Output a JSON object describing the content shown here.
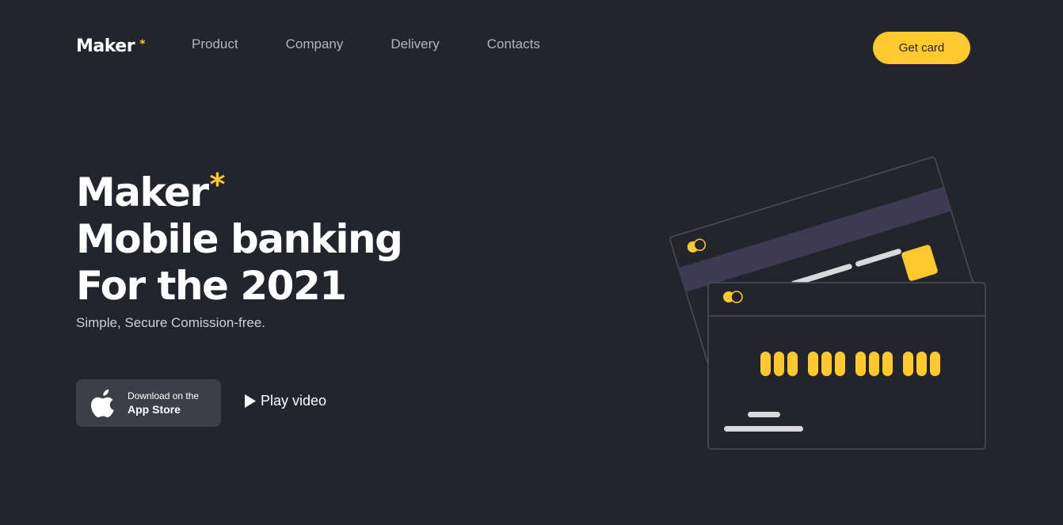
{
  "header": {
    "logo_text": "Maker",
    "logo_star": "*",
    "nav": [
      "Product",
      "Company",
      "Delivery",
      "Contacts"
    ],
    "cta_label": "Get card"
  },
  "hero": {
    "title_line1": "Maker",
    "title_star": "*",
    "title_line2": "Mobile banking",
    "title_line3": "For the 2021",
    "subtitle": "Simple, Secure Comission-free.",
    "appstore_small": "Download on the",
    "appstore_big": "App Store",
    "play_label": "Play video"
  },
  "colors": {
    "background": "#23252d",
    "accent": "#ffc82c",
    "card_stripe": "#3f3a54",
    "button_dark": "#3c3e4a"
  },
  "icons": [
    "apple-icon",
    "play-icon",
    "card-logo-icon",
    "card-chip-icon"
  ]
}
